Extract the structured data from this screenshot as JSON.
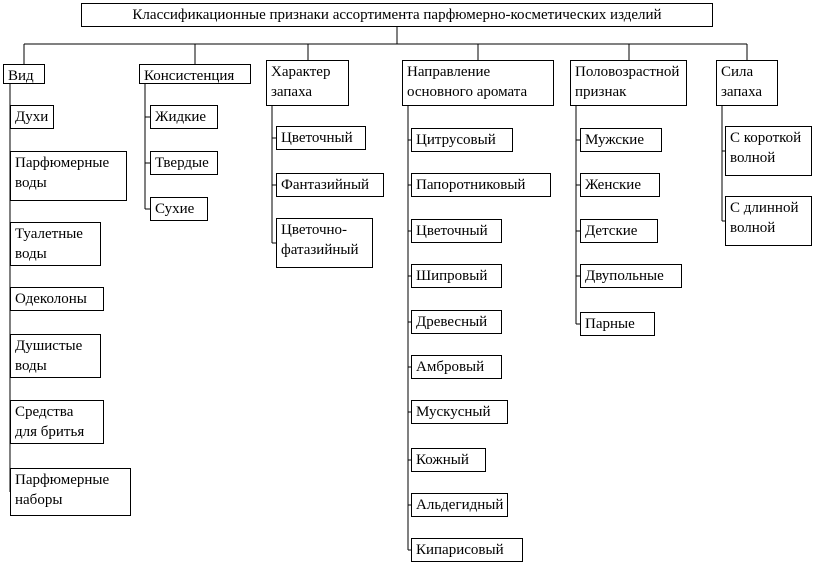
{
  "diagram": {
    "title": "Классификационные признаки ассортимента парфюмерно-косметических изделий",
    "columns": [
      {
        "header": [
          "Вид"
        ],
        "items": [
          [
            "Духи"
          ],
          [
            "Парфюмерные",
            "воды"
          ],
          [
            "Туалетные",
            "воды"
          ],
          [
            "Одеколоны"
          ],
          [
            "Душистые",
            "воды"
          ],
          [
            "Средства",
            "для бритья"
          ],
          [
            "Парфюмерные",
            "наборы"
          ]
        ]
      },
      {
        "header": [
          "Консистенция"
        ],
        "items": [
          [
            "Жидкие"
          ],
          [
            "Твердые"
          ],
          [
            "Сухие"
          ]
        ]
      },
      {
        "header": [
          "Характер",
          "запаха"
        ],
        "items": [
          [
            "Цветочный"
          ],
          [
            "Фантазийный"
          ],
          [
            "Цветочно-",
            "фатазийный"
          ]
        ]
      },
      {
        "header": [
          "Направление",
          "основного аромата"
        ],
        "items": [
          [
            "Цитрусовый"
          ],
          [
            "Папоротниковый"
          ],
          [
            "Цветочный"
          ],
          [
            "Шипровый"
          ],
          [
            "Древесный"
          ],
          [
            "Амбровый"
          ],
          [
            "Мускусный"
          ],
          [
            "Кожный"
          ],
          [
            "Альдегидный"
          ],
          [
            "Кипарисовый"
          ]
        ]
      },
      {
        "header": [
          "Половозрастной",
          "признак"
        ],
        "items": [
          [
            "Мужские"
          ],
          [
            "Женские"
          ],
          [
            "Детские"
          ],
          [
            "Двупольные"
          ],
          [
            "Парные"
          ]
        ]
      },
      {
        "header": [
          "Сила",
          "запаха"
        ],
        "items": [
          [
            "С короткой",
            "волной"
          ],
          [
            "С длинной",
            "волной"
          ]
        ]
      }
    ]
  }
}
